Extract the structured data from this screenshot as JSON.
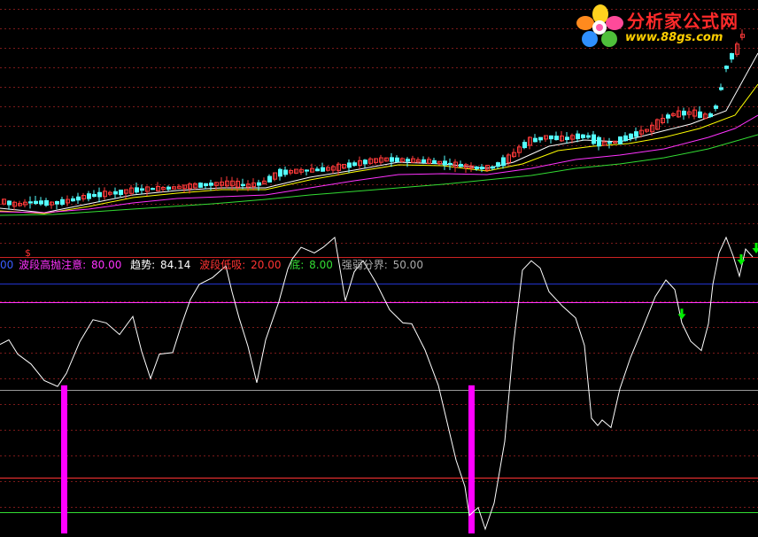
{
  "indicator_legend": {
    "lead_value": "00",
    "high_sell_label": "波段高抛注意:",
    "high_sell_value": "80.00",
    "trend_label": "趋势:",
    "trend_value": "84.14",
    "low_buy_label": "波段低吸:",
    "low_buy_value": "20.00",
    "bottom_label": "底:",
    "bottom_value": "8.00",
    "divide_label": "强弱分界:",
    "divide_value": "50.00"
  },
  "marker_s": "$",
  "logo": {
    "title": "分析家公式网",
    "url": "www.88gs.com"
  },
  "colors": {
    "background": "#000000",
    "up_candle": "#ff3a3a",
    "down_candle": "#54ffff",
    "ma_fast": "#ffffff",
    "ma_mid": "#ffff00",
    "ma_slow": "#ff33ff",
    "ma_long": "#33dd33",
    "trend_line": "#ffffff",
    "high_sell": "#ff33ff",
    "low_buy": "#ff3333",
    "bottom": "#33dd33",
    "divide": "#999999",
    "bottom_bar": "#ff00ff",
    "down_arrow": "#00ee00"
  },
  "chart_data": [
    {
      "type": "candlestick",
      "price_trend": [
        [
          0,
          227
        ],
        [
          20,
          232
        ],
        [
          40,
          228
        ],
        [
          60,
          230
        ],
        [
          80,
          227
        ],
        [
          100,
          222
        ],
        [
          120,
          219
        ],
        [
          140,
          217
        ],
        [
          160,
          214
        ],
        [
          180,
          213
        ],
        [
          200,
          212
        ],
        [
          220,
          210
        ],
        [
          240,
          208
        ],
        [
          260,
          207
        ],
        [
          280,
          210
        ],
        [
          300,
          207
        ],
        [
          320,
          195
        ],
        [
          340,
          193
        ],
        [
          360,
          192
        ],
        [
          380,
          190
        ],
        [
          400,
          186
        ],
        [
          420,
          182
        ],
        [
          440,
          180
        ],
        [
          460,
          181
        ],
        [
          480,
          182
        ],
        [
          500,
          184
        ],
        [
          520,
          187
        ],
        [
          540,
          190
        ],
        [
          560,
          189
        ],
        [
          580,
          178
        ],
        [
          600,
          160
        ],
        [
          620,
          155
        ],
        [
          640,
          157
        ],
        [
          660,
          153
        ],
        [
          680,
          163
        ],
        [
          700,
          160
        ],
        [
          720,
          152
        ],
        [
          740,
          145
        ],
        [
          760,
          130
        ],
        [
          780,
          127
        ],
        [
          800,
          133
        ],
        [
          810,
          128
        ],
        [
          818,
          100
        ],
        [
          826,
          68
        ],
        [
          835,
          58
        ],
        [
          843,
          38
        ]
      ],
      "moving_averages": [
        {
          "name": "MA fast",
          "points": [
            [
              0,
              235
            ],
            [
              50,
              240
            ],
            [
              100,
              230
            ],
            [
              150,
              220
            ],
            [
              200,
              215
            ],
            [
              250,
              212
            ],
            [
              300,
              212
            ],
            [
              350,
              200
            ],
            [
              400,
              192
            ],
            [
              450,
              183
            ],
            [
              500,
              185
            ],
            [
              550,
              190
            ],
            [
              580,
              183
            ],
            [
              620,
              165
            ],
            [
              660,
              158
            ],
            [
              700,
              160
            ],
            [
              740,
              150
            ],
            [
              780,
              140
            ],
            [
              820,
              125
            ],
            [
              856,
              60
            ]
          ]
        },
        {
          "name": "MA mid",
          "points": [
            [
              0,
              238
            ],
            [
              50,
              241
            ],
            [
              100,
              233
            ],
            [
              150,
              223
            ],
            [
              200,
              218
            ],
            [
              250,
              214
            ],
            [
              300,
              214
            ],
            [
              350,
              203
            ],
            [
              400,
              194
            ],
            [
              450,
              186
            ],
            [
              500,
              187
            ],
            [
              550,
              193
            ],
            [
              590,
              185
            ],
            [
              630,
              170
            ],
            [
              670,
              165
            ],
            [
              710,
              162
            ],
            [
              750,
              155
            ],
            [
              790,
              145
            ],
            [
              830,
              130
            ],
            [
              856,
              95
            ]
          ]
        },
        {
          "name": "MA slow",
          "points": [
            [
              0,
              239
            ],
            [
              50,
              240
            ],
            [
              100,
              236
            ],
            [
              150,
              229
            ],
            [
              200,
              224
            ],
            [
              250,
              222
            ],
            [
              300,
              220
            ],
            [
              350,
              212
            ],
            [
              400,
              204
            ],
            [
              450,
              197
            ],
            [
              500,
              196
            ],
            [
              550,
              197
            ],
            [
              600,
              190
            ],
            [
              650,
              180
            ],
            [
              700,
              175
            ],
            [
              750,
              168
            ],
            [
              800,
              155
            ],
            [
              830,
              145
            ],
            [
              856,
              130
            ]
          ]
        },
        {
          "name": "MA long",
          "points": [
            [
              0,
              243
            ],
            [
              60,
              242
            ],
            [
              120,
              238
            ],
            [
              180,
              234
            ],
            [
              240,
              230
            ],
            [
              300,
              225
            ],
            [
              350,
              220
            ],
            [
              400,
              216
            ],
            [
              450,
              212
            ],
            [
              500,
              208
            ],
            [
              550,
              203
            ],
            [
              600,
              198
            ],
            [
              650,
              190
            ],
            [
              700,
              185
            ],
            [
              750,
              178
            ],
            [
              800,
              168
            ],
            [
              856,
              152
            ]
          ]
        }
      ]
    },
    {
      "type": "line",
      "title": "",
      "levels": {
        "high_sell": 80.0,
        "divide": 50.0,
        "low_buy": 20.0,
        "bottom": 8.0
      },
      "ylim": [
        0,
        100
      ],
      "x": [
        0,
        10,
        20,
        35,
        50,
        65,
        75,
        90,
        105,
        120,
        135,
        150,
        160,
        170,
        180,
        195,
        205,
        215,
        225,
        240,
        255,
        262,
        270,
        280,
        290,
        300,
        315,
        325,
        330,
        340,
        355,
        365,
        378,
        390,
        400,
        410,
        425,
        440,
        455,
        465,
        480,
        495,
        505,
        515,
        525,
        530,
        540,
        548,
        558,
        570,
        580,
        590,
        600,
        610,
        620,
        635,
        650,
        660,
        668,
        675,
        680,
        690,
        700,
        712,
        725,
        740,
        752,
        762,
        770,
        780,
        792,
        800,
        805,
        812,
        820,
        828,
        835,
        842,
        850
      ],
      "y": [
        65.5,
        67.1,
        62.2,
        58.8,
        53.1,
        51.1,
        55.6,
        66.4,
        74.0,
        72.9,
        68.9,
        75.1,
        63.1,
        53.8,
        62.2,
        62.7,
        72.3,
        80.9,
        86.1,
        88.4,
        92.4,
        83.6,
        74.6,
        64.9,
        52.4,
        67.1,
        80.2,
        91.4,
        94.8,
        98.8,
        96.9,
        98.8,
        102.2,
        80.5,
        90.4,
        94.2,
        86.5,
        77.4,
        72.9,
        72.6,
        63.6,
        51.5,
        38.7,
        25.9,
        16.8,
        6.9,
        9.6,
        2.2,
        11.1,
        32.3,
        66.0,
        91.0,
        94.2,
        91.7,
        83.6,
        78.7,
        74.6,
        65.2,
        40.2,
        37.7,
        39.6,
        37.0,
        50.3,
        61.0,
        70.5,
        81.9,
        87.6,
        84.3,
        72.9,
        66.6,
        63.4,
        72.6,
        86.1,
        96.9,
        102.2,
        95.8,
        88.9,
        98.2,
        95.5
      ],
      "bottom_signals": [
        {
          "x": 72,
          "value": 51.5
        },
        {
          "x": 532,
          "value": 51.5
        }
      ],
      "sell_arrows": [
        770,
        837,
        854
      ]
    }
  ]
}
